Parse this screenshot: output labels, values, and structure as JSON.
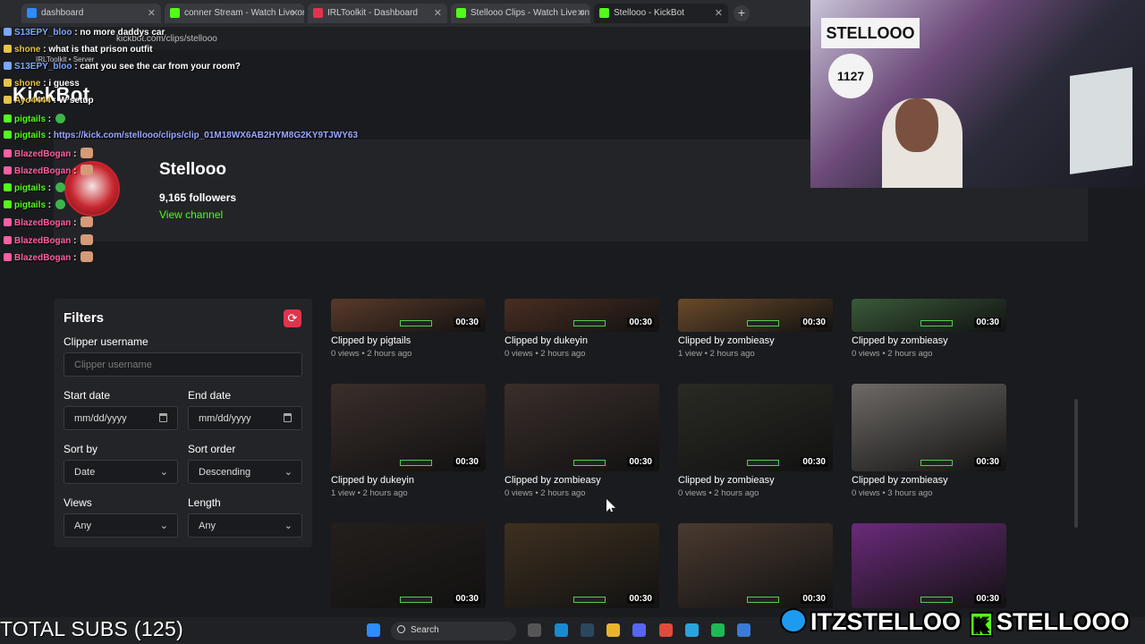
{
  "browser": {
    "tabs": [
      {
        "label": "dashboard",
        "color": "#2d8cff"
      },
      {
        "label": "conner Stream - Watch Live on",
        "color": "#53fc18"
      },
      {
        "label": "IRLToolkit - Dashboard",
        "color": "#e0344c"
      },
      {
        "label": "Stellooo Clips - Watch Live on",
        "color": "#53fc18"
      },
      {
        "label": "Stellooo - KickBot",
        "color": "#53fc18"
      }
    ],
    "url": "kickbot.com/clips/stellooo",
    "bookmark": "IRLToolkit • Server"
  },
  "app": {
    "brand": "KickBot"
  },
  "channel": {
    "name": "Stellooo",
    "followers": "9,165 followers",
    "view_link": "View channel"
  },
  "chat": [
    {
      "user": "S13EPY_bloo",
      "color": "#7aa7ff",
      "msg": "no more daddys car"
    },
    {
      "user": "shone",
      "color": "#e6c34a",
      "msg": "what is that prison outfit"
    },
    {
      "user": "S13EPY_bloo",
      "color": "#7aa7ff",
      "msg": "cant you see the car from your room?"
    },
    {
      "user": "shone",
      "color": "#e6c34a",
      "msg": "i guess"
    },
    {
      "user": "Ayo4444",
      "color": "#e6c34a",
      "msg": "W setup"
    },
    {
      "user": "pigtails",
      "color": "#53fc18",
      "msg": ""
    },
    {
      "user": "pigtails",
      "color": "#53fc18",
      "msg": "https://kick.com/stellooo/clips/clip_01M18WX6AB2HYM8G2KY9TJWY63"
    },
    {
      "user": "BlazedBogan",
      "color": "#ff5fa2",
      "msg": ""
    },
    {
      "user": "BlazedBogan",
      "color": "#ff5fa2",
      "msg": ""
    },
    {
      "user": "pigtails",
      "color": "#53fc18",
      "msg": ""
    },
    {
      "user": "pigtails",
      "color": "#53fc18",
      "msg": ""
    },
    {
      "user": "BlazedBogan",
      "color": "#ff5fa2",
      "msg": ""
    },
    {
      "user": "BlazedBogan",
      "color": "#ff5fa2",
      "msg": ""
    },
    {
      "user": "BlazedBogan",
      "color": "#ff5fa2",
      "msg": ""
    }
  ],
  "filters": {
    "title": "Filters",
    "clipper_label": "Clipper username",
    "clipper_placeholder": "Clipper username",
    "start_label": "Start date",
    "start_value": "mm/dd/yyyy",
    "end_label": "End date",
    "end_value": "mm/dd/yyyy",
    "sort_by_label": "Sort by",
    "sort_by_value": "Date",
    "sort_order_label": "Sort order",
    "sort_order_value": "Descending",
    "views_label": "Views",
    "views_value": "Any",
    "length_label": "Length",
    "length_value": "Any"
  },
  "clips": [
    {
      "title": "Clipped by pigtails",
      "meta": "0 views • 2 hours ago",
      "duration": "00:30",
      "tone": "#5a3a2a"
    },
    {
      "title": "Clipped by dukeyin",
      "meta": "0 views • 2 hours ago",
      "duration": "00:30",
      "tone": "#4a2e22"
    },
    {
      "title": "Clipped by zombieasy",
      "meta": "1 view • 2 hours ago",
      "duration": "00:30",
      "tone": "#6a4a2a"
    },
    {
      "title": "Clipped by zombieasy",
      "meta": "0 views • 2 hours ago",
      "duration": "00:30",
      "tone": "#3a5a3a"
    },
    {
      "title": "Clipped by dukeyin",
      "meta": "1 view • 2 hours ago",
      "duration": "00:30",
      "tone": "#3a2e2a"
    },
    {
      "title": "Clipped by zombieasy",
      "meta": "0 views • 2 hours ago",
      "duration": "00:30",
      "tone": "#3a2e2a"
    },
    {
      "title": "Clipped by zombieasy",
      "meta": "0 views • 2 hours ago",
      "duration": "00:30",
      "tone": "#2a2a24"
    },
    {
      "title": "Clipped by zombieasy",
      "meta": "0 views • 3 hours ago",
      "duration": "00:30",
      "tone": "#6e6a66"
    },
    {
      "title": "",
      "meta": "",
      "duration": "00:30",
      "tone": "#241f1c"
    },
    {
      "title": "",
      "meta": "",
      "duration": "00:30",
      "tone": "#3e3020"
    },
    {
      "title": "",
      "meta": "",
      "duration": "00:30",
      "tone": "#4a3a30"
    },
    {
      "title": "",
      "meta": "",
      "duration": "00:30",
      "tone": "#6a2a7a"
    }
  ],
  "overlay": {
    "total_subs": "TOTAL SUBS (125)",
    "twitter": "ITZSTELLOO",
    "kick": "STELLOOO",
    "webcam_poster": "STELLOOO",
    "webcam_sticker": "1127"
  },
  "taskbar": {
    "search_label": "Search"
  },
  "colors": {
    "accent_green": "#53fc18",
    "accent_red": "#e0344c"
  }
}
